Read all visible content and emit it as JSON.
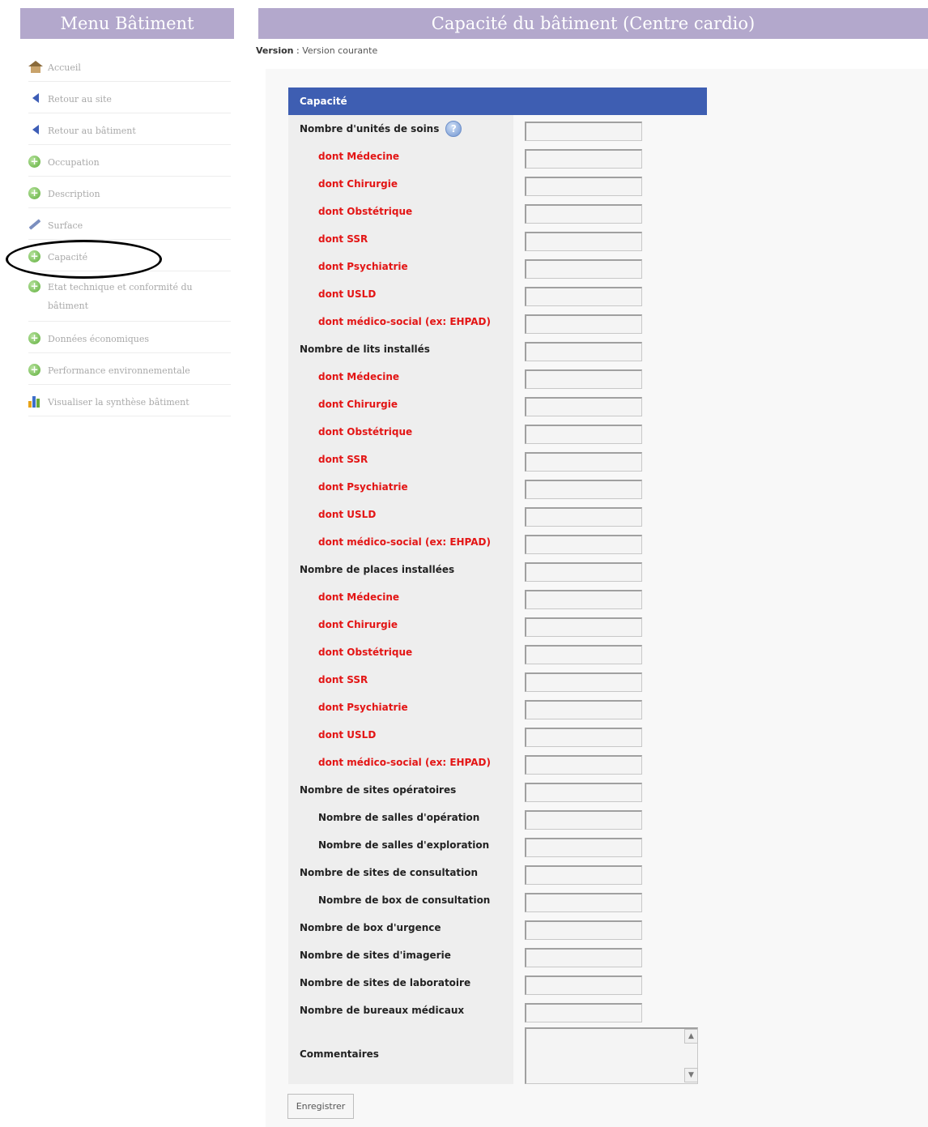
{
  "sidebar": {
    "title": "Menu Bâtiment",
    "items": [
      {
        "label": "Accueil",
        "icon": "home-icon"
      },
      {
        "label": "Retour au site",
        "icon": "back-arrow-icon"
      },
      {
        "label": "Retour au bâtiment",
        "icon": "back-arrow-icon"
      },
      {
        "label": "Occupation",
        "icon": "plus-circle-icon"
      },
      {
        "label": "Description",
        "icon": "plus-circle-icon"
      },
      {
        "label": "Surface",
        "icon": "pencil-icon"
      },
      {
        "label": "Capacité",
        "icon": "plus-circle-icon"
      },
      {
        "label": "Etat technique et conformité du bâtiment",
        "icon": "plus-circle-icon"
      },
      {
        "label": "Données économiques",
        "icon": "plus-circle-icon"
      },
      {
        "label": "Performance environnementale",
        "icon": "plus-circle-icon"
      },
      {
        "label": "Visualiser la synthèse bâtiment",
        "icon": "bar-chart-icon"
      }
    ]
  },
  "header": {
    "title": "Capacité du bâtiment (Centre cardio)"
  },
  "version": {
    "label": "Version",
    "value": "Version courante"
  },
  "form": {
    "section_title": "Capacité",
    "rows": [
      {
        "label": "Nombre d'unités de soins",
        "value": "",
        "help": true
      },
      {
        "label": "dont Médecine",
        "value": ""
      },
      {
        "label": "dont Chirurgie",
        "value": ""
      },
      {
        "label": "dont Obstétrique",
        "value": ""
      },
      {
        "label": "dont SSR",
        "value": ""
      },
      {
        "label": "dont Psychiatrie",
        "value": ""
      },
      {
        "label": "dont USLD",
        "value": ""
      },
      {
        "label": "dont médico-social (ex: EHPAD)",
        "value": ""
      },
      {
        "label": "Nombre de lits installés",
        "value": ""
      },
      {
        "label": "dont Médecine",
        "value": ""
      },
      {
        "label": "dont Chirurgie",
        "value": ""
      },
      {
        "label": "dont Obstétrique",
        "value": ""
      },
      {
        "label": "dont SSR",
        "value": ""
      },
      {
        "label": "dont Psychiatrie",
        "value": ""
      },
      {
        "label": "dont USLD",
        "value": ""
      },
      {
        "label": "dont médico-social (ex: EHPAD)",
        "value": ""
      },
      {
        "label": "Nombre de places installées",
        "value": ""
      },
      {
        "label": "dont Médecine",
        "value": ""
      },
      {
        "label": "dont Chirurgie",
        "value": ""
      },
      {
        "label": "dont Obstétrique",
        "value": ""
      },
      {
        "label": "dont SSR",
        "value": ""
      },
      {
        "label": "dont Psychiatrie",
        "value": ""
      },
      {
        "label": "dont USLD",
        "value": ""
      },
      {
        "label": "dont médico-social (ex: EHPAD)",
        "value": ""
      },
      {
        "label": "Nombre de sites opératoires",
        "value": ""
      },
      {
        "label": "Nombre de salles d'opération",
        "value": ""
      },
      {
        "label": "Nombre de salles d'exploration",
        "value": ""
      },
      {
        "label": "Nombre de sites de consultation",
        "value": ""
      },
      {
        "label": "Nombre de box de consultation",
        "value": ""
      },
      {
        "label": "Nombre de box d'urgence",
        "value": ""
      },
      {
        "label": "Nombre de sites d'imagerie",
        "value": ""
      },
      {
        "label": "Nombre de sites de laboratoire",
        "value": ""
      },
      {
        "label": "Nombre de bureaux médicaux",
        "value": ""
      }
    ],
    "comment_label": "Commentaires",
    "comment_value": "",
    "save_label": "Enregistrer"
  },
  "colors": {
    "header_bg": "#b3a8cc",
    "table_head_bg": "#3e5eb2",
    "sub_label": "#e31515"
  }
}
